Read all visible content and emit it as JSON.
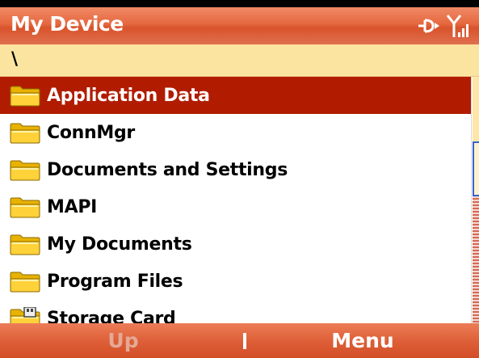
{
  "titlebar": {
    "title": "My Device"
  },
  "status": {
    "connection_icon": "data-connection-icon",
    "signal_icon": "signal-strength-icon"
  },
  "path": {
    "current": "\\"
  },
  "files": [
    {
      "label": "Application Data",
      "icon": "folder-icon",
      "selected": true
    },
    {
      "label": "ConnMgr",
      "icon": "folder-icon",
      "selected": false
    },
    {
      "label": "Documents and Settings",
      "icon": "folder-icon",
      "selected": false
    },
    {
      "label": "MAPI",
      "icon": "folder-icon",
      "selected": false
    },
    {
      "label": "My Documents",
      "icon": "folder-icon",
      "selected": false
    },
    {
      "label": "Program Files",
      "icon": "folder-icon",
      "selected": false
    },
    {
      "label": "Storage Card",
      "icon": "storage-card-folder-icon",
      "selected": false
    }
  ],
  "softkeys": {
    "left": "Up",
    "right": "Menu"
  },
  "colors": {
    "titlebar": "#e5683f",
    "selection": "#b11c00",
    "pathbar": "#fbe4a0",
    "scroll_thumb_border": "#3a62d0"
  }
}
